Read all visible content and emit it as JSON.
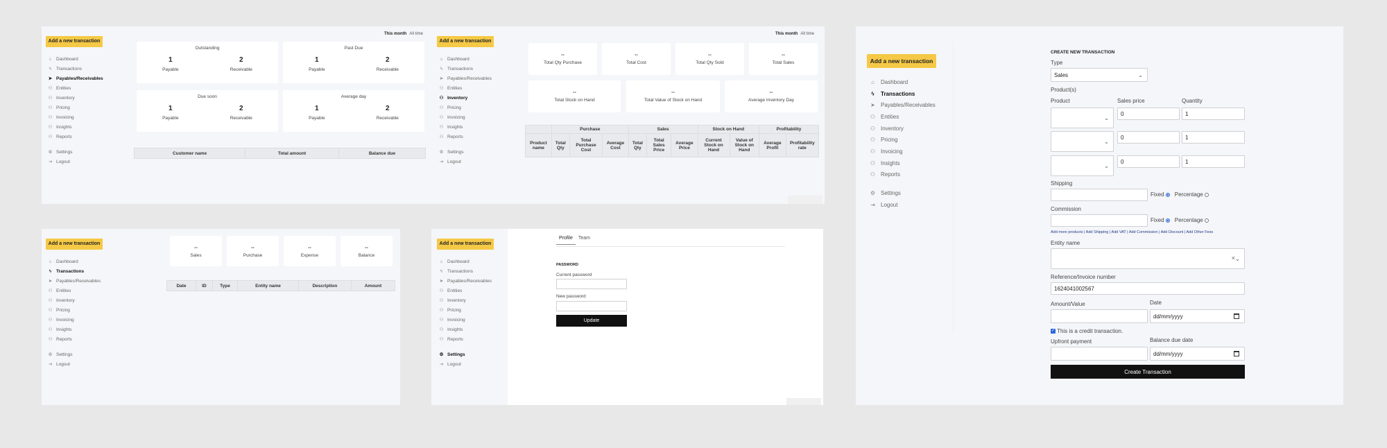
{
  "common": {
    "add_transaction": "Add a new transaction",
    "nav": {
      "dashboard": "Dashboard",
      "transactions": "Transactions",
      "payables": "Payables/Receivables",
      "entities": "Entities",
      "inventory": "Inventory",
      "pricing": "Pricing",
      "invoicing": "Invoicing",
      "insights": "Insights",
      "reports": "Reports",
      "settings": "Settings",
      "logout": "Logout"
    },
    "range": {
      "month": "This month",
      "all": "All time"
    }
  },
  "payables_screen": {
    "cards": [
      {
        "title": "Outstanding",
        "payable": "1",
        "receivable": "2"
      },
      {
        "title": "Past Due",
        "payable": "1",
        "receivable": "2"
      },
      {
        "title": "Due soon",
        "payable": "1",
        "receivable": "2"
      },
      {
        "title": "Average day",
        "payable": "1",
        "receivable": "2"
      }
    ],
    "payable_label": "Payable",
    "receivable_label": "Receivable",
    "table_headers": [
      "Customer name",
      "Total amount",
      "Balance due"
    ]
  },
  "inventory_screen": {
    "cards_row1": [
      {
        "value": "--",
        "label": "Total Qty Purchase"
      },
      {
        "value": "--",
        "label": "Total Cost"
      },
      {
        "value": "--",
        "label": "Total Qty Sold"
      },
      {
        "value": "--",
        "label": "Total Sales"
      }
    ],
    "cards_row2": [
      {
        "value": "--",
        "label": "Total Stock on Hand"
      },
      {
        "value": "--",
        "label": "Total Value of Stock on Hand"
      },
      {
        "value": "--",
        "label": "Average Inventory Day"
      }
    ],
    "groups": [
      "Purchase",
      "Sales",
      "Stock on Hand",
      "Profitability"
    ],
    "headers": [
      "Product name",
      "Total Qty",
      "Total Purchase Cost",
      "Average Cost",
      "Total Qty",
      "Total Sales Price",
      "Average Price",
      "Current Stock on Hand",
      "Value of Stock on Hand",
      "Average Profit",
      "Profitability rate"
    ]
  },
  "transactions_screen": {
    "cards": [
      {
        "value": "--",
        "label": "Sales"
      },
      {
        "value": "--",
        "label": "Purchase"
      },
      {
        "value": "--",
        "label": "Expense"
      },
      {
        "value": "--",
        "label": "Balance"
      }
    ],
    "headers": [
      "Date",
      "ID",
      "Type",
      "Entity name",
      "Description",
      "Amount"
    ]
  },
  "settings_screen": {
    "tabs": [
      "Profile",
      "Team"
    ],
    "section": "PASSWORD",
    "current_password": "Current password",
    "new_password": "New password",
    "update": "Update"
  },
  "create_screen": {
    "heading": "CREATE NEW TRANSACTION",
    "type_label": "Type",
    "type_value": "Sales",
    "products_label": "Product(s)",
    "col_product": "Product",
    "col_price": "Sales price",
    "col_qty": "Quantity",
    "rows": [
      {
        "price": "0",
        "qty": "1"
      },
      {
        "price": "0",
        "qty": "1"
      },
      {
        "price": "0",
        "qty": "1"
      }
    ],
    "shipping_label": "Shipping",
    "commission_label": "Commission",
    "fixed": "Fixed",
    "percentage": "Percentage",
    "add_links": "Add more products | Add Shipping | Add VAT | Add Commission | Add Discount | Add Other Fees",
    "entity_label": "Entity name",
    "reference_label": "Reference/Invoice number",
    "reference_value": "1624041002567",
    "amount_label": "Amount/Value",
    "date_label": "Date",
    "date_placeholder": "dd/mm/yyyy",
    "credit_label": "This is a credit transaction.",
    "upfront_label": "Upfront payment",
    "balance_due_label": "Balance due date",
    "balance_placeholder": "dd/mm/yyyy",
    "submit": "Create Transaction"
  }
}
